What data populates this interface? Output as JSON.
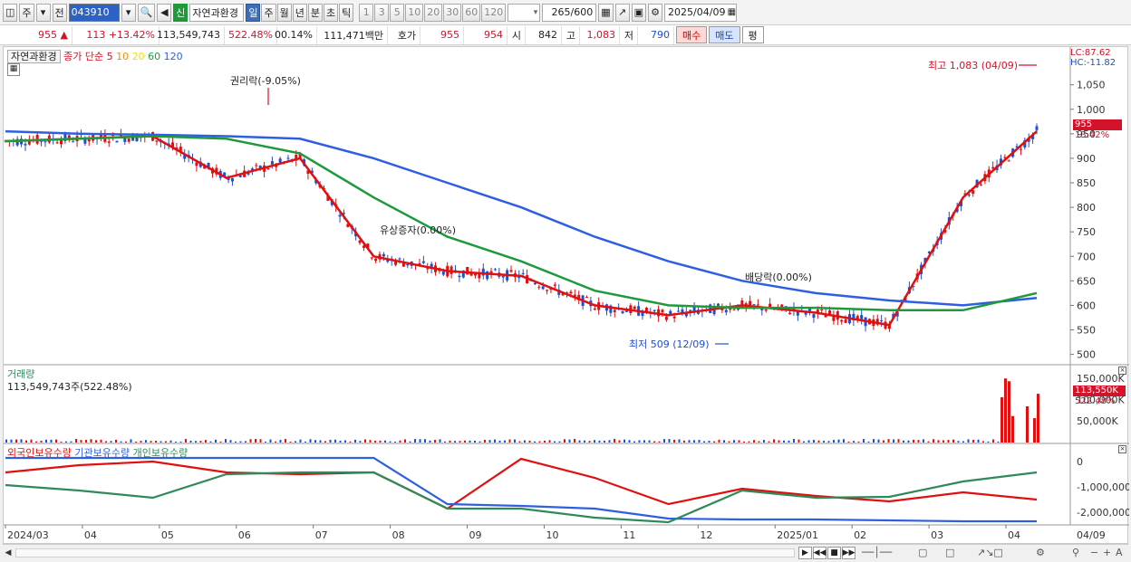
{
  "toolbar": {
    "market_label": "주",
    "prev_label": "전",
    "code": "043910",
    "new_badge": "신",
    "name": "자연과환경",
    "period_tabs": [
      "일",
      "주",
      "월",
      "년",
      "분",
      "초",
      "틱"
    ],
    "active_period": "일",
    "minute_options": [
      "1",
      "3",
      "5",
      "10",
      "20",
      "30",
      "60",
      "120"
    ],
    "count_value": "265",
    "count_total": "/600",
    "date": "2025/04/09"
  },
  "quote": {
    "price": "955",
    "change_arrow": "▲",
    "change": "113",
    "change_pct": "+13.42%",
    "volume": "113,549,743",
    "volume_ratio": "522.48%",
    "turnover_pct": "00.14%",
    "trade_value": "111,471백만",
    "hoga_label": "호가",
    "ask": "955",
    "bid": "954",
    "open_label": "시",
    "open": "842",
    "high_label": "고",
    "high": "1,083",
    "low_label": "저",
    "low": "790",
    "buy_label": "매수",
    "sell_label": "매도",
    "avg_label": "평"
  },
  "price_pane": {
    "stock_label": "자연과환경",
    "ma_prefix": "종가 단순",
    "ma_periods": [
      "5",
      "10",
      "20",
      "60",
      "120"
    ],
    "ma_colors": [
      "#e01010",
      "#f08c00",
      "#f0e000",
      "#1e9a3c",
      "#2e5fe0"
    ],
    "lc_label": "LC:87.62",
    "hc_label": "HC:-11.82",
    "current_price_tag": "955",
    "current_pct_tag": "13.42%",
    "annotations": {
      "rights": "권리락(-9.05%)",
      "bonus": "유상증자(0.00%)",
      "dividend": "배당락(0.00%)",
      "low_mark": "최저 509 (12/09)",
      "high_mark": "최고 1,083 (04/09)"
    },
    "y_ticks": [
      "1,050",
      "1,000",
      "950",
      "900",
      "850",
      "800",
      "750",
      "700",
      "650",
      "600",
      "550",
      "500"
    ]
  },
  "volume_pane": {
    "title": "거래량",
    "detail": "113,549,743주(522.48%)",
    "y_ticks": [
      "150,000K",
      "100,000K",
      "50,000K"
    ],
    "current_tag": "113,550K",
    "current_pct_tag": "522.48%"
  },
  "holdings_pane": {
    "series_labels": [
      "외국인보유수량",
      "기관보유수량",
      "개인보유수량"
    ],
    "series_colors": [
      "#e01010",
      "#2e5fe0",
      "#2e8a5a"
    ],
    "y_ticks": [
      "0",
      "-1,000,000",
      "-2,000,000"
    ]
  },
  "x_axis": {
    "labels": [
      "2024/03",
      "04",
      "05",
      "06",
      "07",
      "08",
      "09",
      "10",
      "11",
      "12",
      "2025/01",
      "02",
      "03",
      "04"
    ],
    "end_label": "04/09"
  },
  "chart_data": {
    "type": "line",
    "title": "자연과환경",
    "ylim": [
      490,
      1090
    ],
    "series": [
      {
        "name": "종가",
        "x": [
          "2024/03",
          "04",
          "05",
          "06",
          "07",
          "08",
          "09",
          "10",
          "11",
          "12",
          "2025/01",
          "02",
          "03",
          "04",
          "04/09"
        ],
        "values": [
          935,
          940,
          945,
          860,
          900,
          700,
          670,
          660,
          600,
          580,
          600,
          585,
          560,
          820,
          955
        ]
      },
      {
        "name": "120",
        "x": [
          "2024/03",
          "04",
          "05",
          "06",
          "07",
          "08",
          "09",
          "10",
          "11",
          "12",
          "2025/01",
          "02",
          "03",
          "04",
          "04/09"
        ],
        "values": [
          955,
          950,
          948,
          945,
          940,
          900,
          850,
          800,
          740,
          690,
          650,
          625,
          610,
          600,
          615
        ]
      },
      {
        "name": "60",
        "x": [
          "2024/03",
          "04",
          "05",
          "06",
          "07",
          "08",
          "09",
          "10",
          "11",
          "12",
          "2025/01",
          "02",
          "03",
          "04",
          "04/09"
        ],
        "values": [
          935,
          940,
          945,
          940,
          910,
          820,
          740,
          690,
          630,
          600,
          595,
          595,
          590,
          590,
          625
        ]
      }
    ],
    "annotations": [
      "권리락(-9.05%)",
      "유상증자(0.00%)",
      "배당락(0.00%)",
      "최저 509 (12/09)",
      "최고 1,083 (04/09)"
    ]
  }
}
